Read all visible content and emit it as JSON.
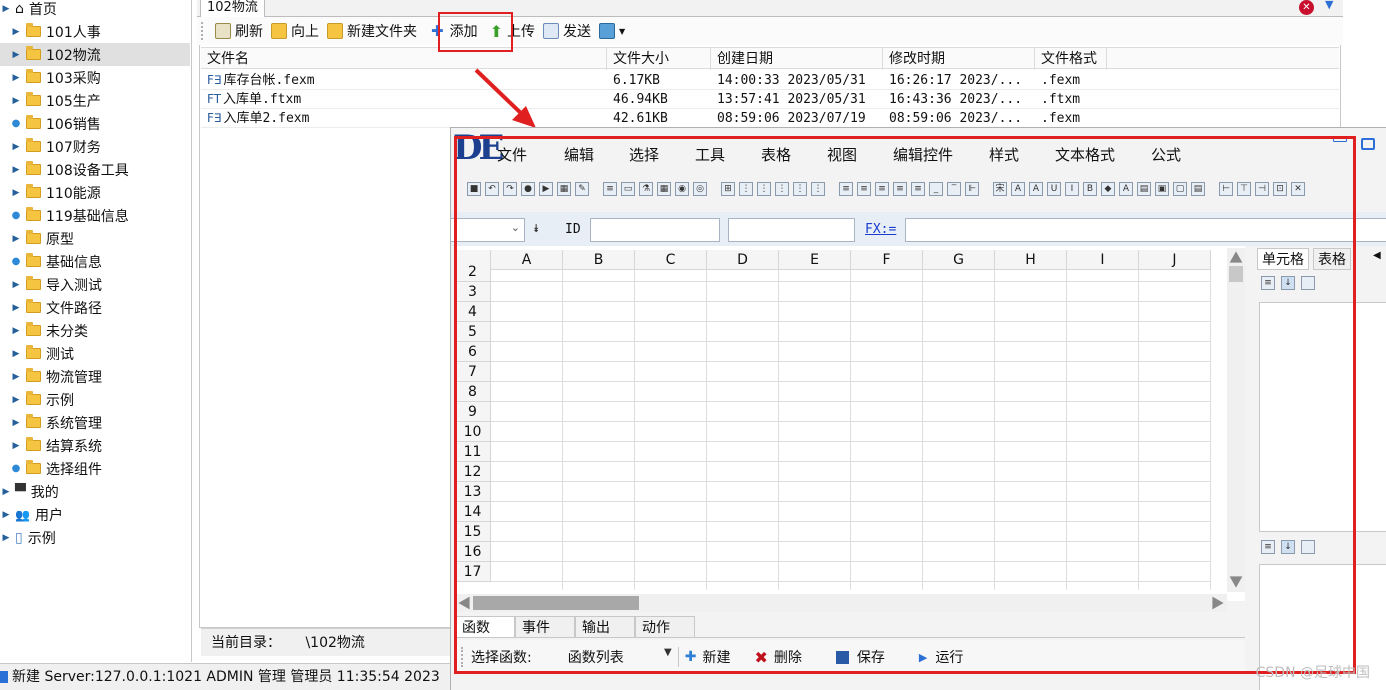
{
  "sidebar": {
    "items": [
      {
        "label": "首页",
        "kind": "home",
        "selected": false,
        "indent": 0
      },
      {
        "label": "101人事",
        "kind": "folder",
        "selected": false,
        "indent": 1
      },
      {
        "label": "102物流",
        "kind": "folder",
        "selected": true,
        "indent": 1
      },
      {
        "label": "103采购",
        "kind": "folder",
        "selected": false,
        "indent": 1
      },
      {
        "label": "105生产",
        "kind": "folder",
        "selected": false,
        "indent": 1
      },
      {
        "label": "106销售",
        "kind": "folder-leaf",
        "selected": false,
        "indent": 1
      },
      {
        "label": "107财务",
        "kind": "folder",
        "selected": false,
        "indent": 1
      },
      {
        "label": "108设备工具",
        "kind": "folder",
        "selected": false,
        "indent": 1
      },
      {
        "label": "110能源",
        "kind": "folder",
        "selected": false,
        "indent": 1
      },
      {
        "label": "119基础信息",
        "kind": "folder-leaf",
        "selected": false,
        "indent": 1
      },
      {
        "label": "原型",
        "kind": "folder",
        "selected": false,
        "indent": 1
      },
      {
        "label": "基础信息",
        "kind": "folder-leaf",
        "selected": false,
        "indent": 1
      },
      {
        "label": "导入测试",
        "kind": "folder",
        "selected": false,
        "indent": 1
      },
      {
        "label": "文件路径",
        "kind": "folder",
        "selected": false,
        "indent": 1
      },
      {
        "label": "未分类",
        "kind": "folder",
        "selected": false,
        "indent": 1
      },
      {
        "label": "测试",
        "kind": "folder",
        "selected": false,
        "indent": 1
      },
      {
        "label": "物流管理",
        "kind": "folder",
        "selected": false,
        "indent": 1
      },
      {
        "label": "示例",
        "kind": "folder",
        "selected": false,
        "indent": 1
      },
      {
        "label": "系统管理",
        "kind": "folder",
        "selected": false,
        "indent": 1
      },
      {
        "label": "结算系统",
        "kind": "folder",
        "selected": false,
        "indent": 1
      },
      {
        "label": "选择组件",
        "kind": "folder-leaf",
        "selected": false,
        "indent": 1
      },
      {
        "label": "我的",
        "kind": "monitor",
        "selected": false,
        "indent": 0
      },
      {
        "label": "用户",
        "kind": "users",
        "selected": false,
        "indent": 0
      },
      {
        "label": "示例",
        "kind": "doc",
        "selected": false,
        "indent": 0
      }
    ]
  },
  "panel": {
    "tab_label": "102物流",
    "toolbar": {
      "refresh": "刷新",
      "up": "向上",
      "new_folder": "新建文件夹",
      "add": "添加",
      "upload": "上传",
      "send": "发送"
    },
    "columns": [
      "文件名",
      "文件大小",
      "创建日期",
      "修改时期",
      "文件格式"
    ],
    "files": [
      {
        "type_icon": "F∃",
        "name": "库存台帐.fexm",
        "size": "6.17KB",
        "created": "14:00:33 2023/05/31",
        "modified": "16:26:17 2023/...",
        "format": ".fexm"
      },
      {
        "type_icon": "FT",
        "name": "入库单.ftxm",
        "size": "46.94KB",
        "created": "13:57:41 2023/05/31",
        "modified": "16:43:36 2023/...",
        "format": ".ftxm"
      },
      {
        "type_icon": "F∃",
        "name": "入库单2.fexm",
        "size": "42.61KB",
        "created": "08:59:06 2023/07/19",
        "modified": "08:59:06 2023/...",
        "format": ".fexm"
      }
    ],
    "path_label": "当前目录：",
    "path_value": "\\102物流"
  },
  "statusbar": {
    "text": "新建  Server:127.0.0.1:1021  ADMIN 管理 管理员 11:35:54 2023"
  },
  "editor": {
    "logo": "DE",
    "menu": [
      "文件",
      "编辑",
      "选择",
      "工具",
      "表格",
      "视图",
      "编辑控件",
      "样式",
      "文本格式",
      "公式"
    ],
    "formula_bar": {
      "id_label": "ID",
      "fx_label": "FX:="
    },
    "columns": [
      "A",
      "B",
      "C",
      "D",
      "E",
      "F",
      "G",
      "H",
      "I",
      "J"
    ],
    "rows": [
      "2",
      "3",
      "4",
      "5",
      "6",
      "7",
      "8",
      "9",
      "10",
      "11",
      "12",
      "13",
      "14",
      "15",
      "16",
      "17"
    ],
    "right_tabs": [
      "单元格",
      "表格"
    ],
    "bottom_tabs": [
      "函数",
      "事件",
      "输出",
      "动作"
    ],
    "bottom_bar": {
      "select_label": "选择函数:",
      "select_value": "函数列表",
      "new": "新建",
      "delete": "删除",
      "save": "保存",
      "run": "运行"
    }
  },
  "watermark": "CSDN @足球中国",
  "colors": {
    "highlight": "#e02020",
    "selected_row": "#e0e0e0",
    "link": "#1a3fd0"
  }
}
